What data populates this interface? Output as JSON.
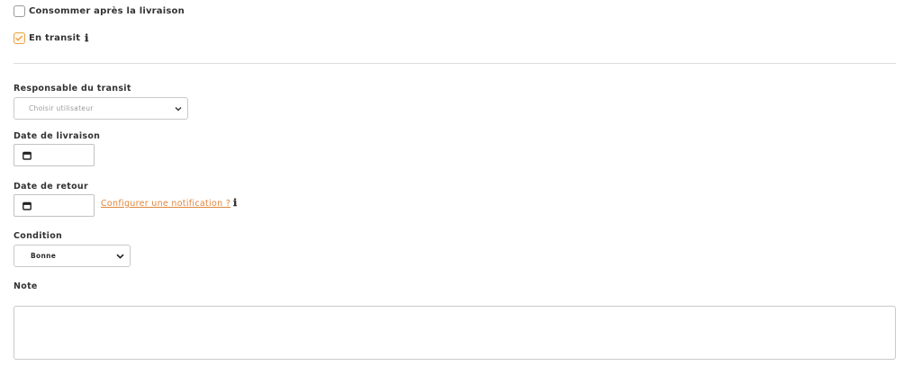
{
  "consume_after_delivery": {
    "label": "Consommer après la livraison",
    "checked": false
  },
  "in_transit": {
    "label": "En transit",
    "checked": true,
    "info_icon": "info-icon"
  },
  "transit_owner": {
    "label": "Responsable du transit",
    "placeholder": "Choisir utilisateur"
  },
  "delivery_date": {
    "label": "Date de livraison",
    "icon": "calendar-icon"
  },
  "return_date": {
    "label": "Date de retour",
    "icon": "calendar-icon",
    "notification_link": "Configurer une notification ?"
  },
  "condition": {
    "label": "Condition",
    "selected": "Bonne"
  },
  "note": {
    "label": "Note"
  },
  "colors": {
    "accent": "#e0853c",
    "checkbox_checked": "#e8a44a",
    "divider": "#dcdcdc"
  }
}
